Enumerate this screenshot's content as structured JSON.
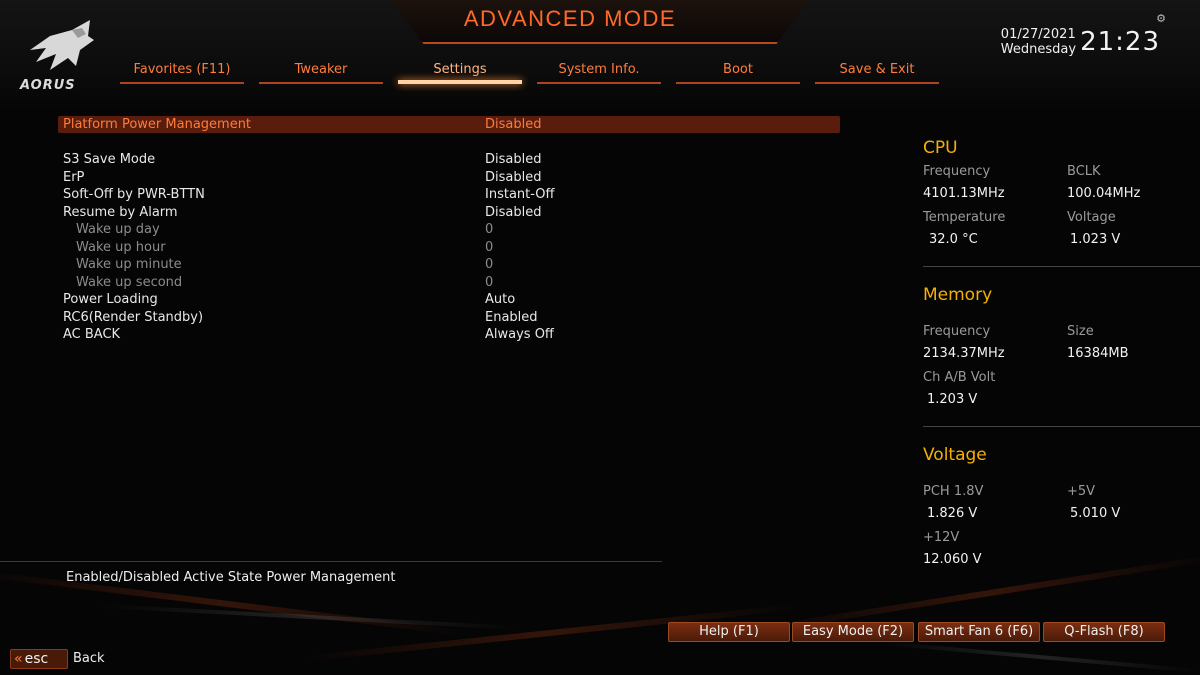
{
  "header": {
    "title": "ADVANCED MODE",
    "brand": "AORUS",
    "date": "01/27/2021",
    "weekday": "Wednesday",
    "time": "21:23"
  },
  "tabs": [
    {
      "label": "Favorites (F11)",
      "active": false
    },
    {
      "label": "Tweaker",
      "active": false
    },
    {
      "label": "Settings",
      "active": true
    },
    {
      "label": "System Info.",
      "active": false
    },
    {
      "label": "Boot",
      "active": false
    },
    {
      "label": "Save & Exit",
      "active": false
    }
  ],
  "settings": {
    "selected": {
      "label": "Platform Power Management",
      "value": "Disabled"
    },
    "rows": [
      {
        "label": "S3 Save Mode",
        "value": "Disabled"
      },
      {
        "label": "ErP",
        "value": "Disabled"
      },
      {
        "label": "Soft-Off by PWR-BTTN",
        "value": "Instant-Off"
      },
      {
        "label": "Resume by Alarm",
        "value": "Disabled"
      },
      {
        "label": "Wake up day",
        "value": "0"
      },
      {
        "label": "Wake up hour",
        "value": "0"
      },
      {
        "label": "Wake up minute",
        "value": "0"
      },
      {
        "label": "Wake up second",
        "value": "0"
      },
      {
        "label": "Power Loading",
        "value": "Auto"
      },
      {
        "label": "RC6(Render Standby)",
        "value": "Enabled"
      },
      {
        "label": "AC BACK",
        "value": "Always Off"
      }
    ]
  },
  "help_text": "Enabled/Disabled Active State Power Management",
  "sidebar": {
    "cpu": {
      "title": "CPU",
      "frequency_label": "Frequency",
      "frequency": "4101.13MHz",
      "bclk_label": "BCLK",
      "bclk": "100.04MHz",
      "temperature_label": "Temperature",
      "temperature": "32.0 °C",
      "voltage_label": "Voltage",
      "voltage": "1.023 V"
    },
    "memory": {
      "title": "Memory",
      "frequency_label": "Frequency",
      "frequency": "2134.37MHz",
      "size_label": "Size",
      "size": "16384MB",
      "volt_label": "Ch A/B Volt",
      "volt": "1.203 V"
    },
    "voltage": {
      "title": "Voltage",
      "pch_label": "PCH 1.8V",
      "pch": "1.826 V",
      "v5_label": "+5V",
      "v5": "5.010 V",
      "v12_label": "+12V",
      "v12": "12.060 V"
    }
  },
  "footer": {
    "buttons": [
      "Help (F1)",
      "Easy Mode (F2)",
      "Smart Fan 6 (F6)",
      "Q-Flash (F8)"
    ],
    "esc_label": "esc",
    "back_label": "Back"
  }
}
